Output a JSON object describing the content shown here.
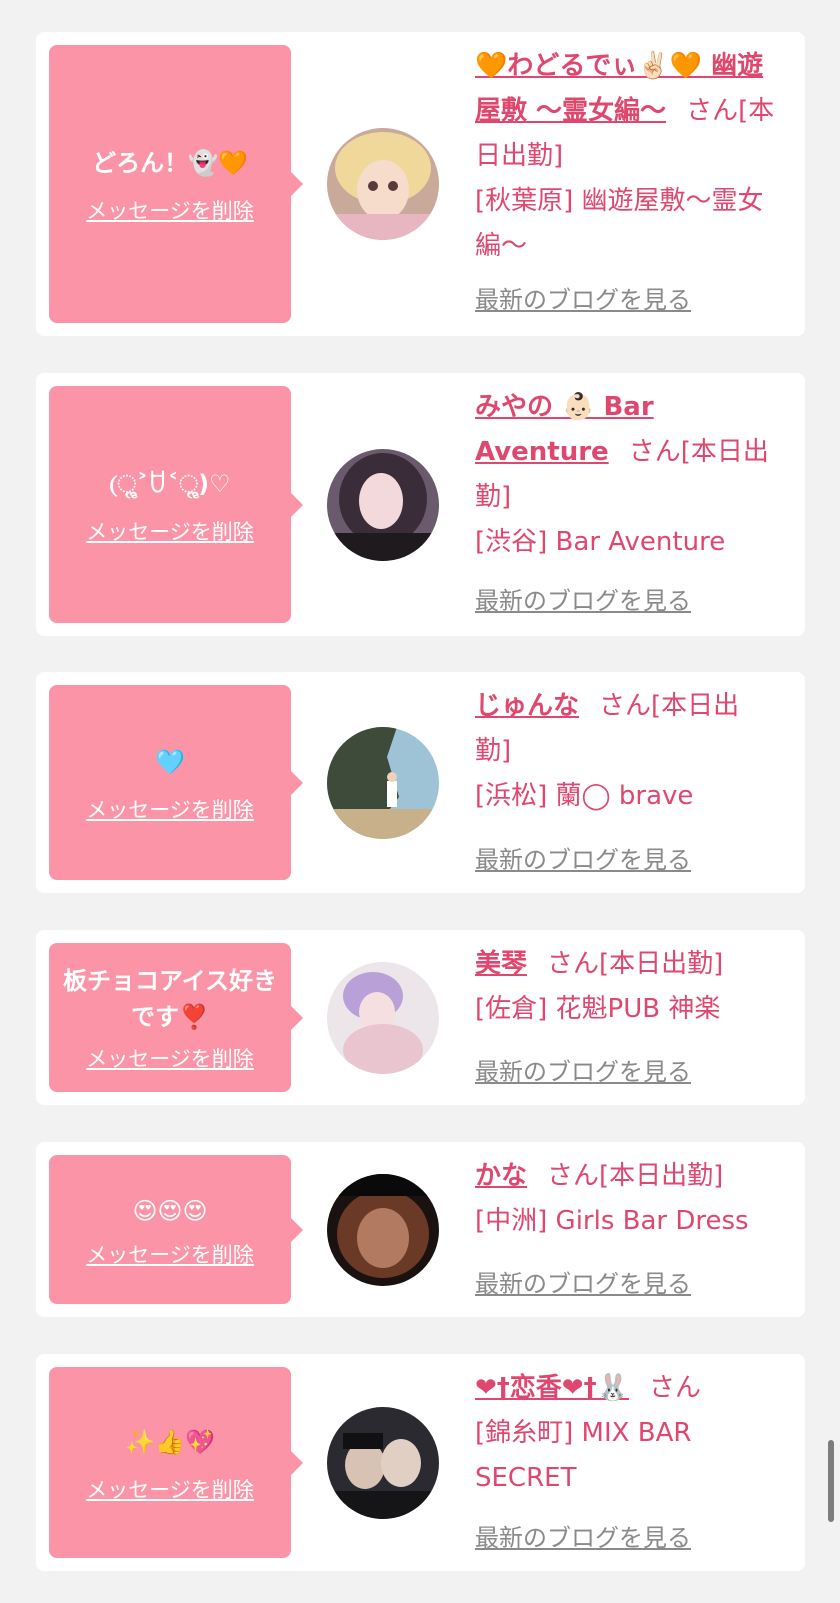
{
  "delete_label": "メッセージを削除",
  "blog_label": "最新のブログを見る",
  "colors": {
    "bubble": "#fa94a6",
    "name": "#e0476f",
    "link_gray": "#8a8a8a",
    "background": "#f2f2f2"
  },
  "cards": [
    {
      "message": "どろん！👻🧡",
      "name": "🧡わどるでぃ✌🏻🧡 幽遊屋敷 〜霊女編〜",
      "san": "さん[本日出勤]",
      "shop": "[秋葉原] 幽遊屋敷〜霊女編〜"
    },
    {
      "message": "(ૢ˃ꇴ˂ૢ)♡",
      "name": "みやの 👶🏻 Bar Aventure",
      "san": "さん[本日出勤]",
      "shop": "[渋谷] Bar Aventure"
    },
    {
      "message": "🩵",
      "name": "じゅんな",
      "san": "さん[本日出勤]",
      "shop": "[浜松] 蘭◯ brave"
    },
    {
      "message": "板チョコアイス好きです❣️",
      "name": "美琴",
      "san": "さん[本日出勤]",
      "shop": "[佐倉] 花魁PUB 神楽"
    },
    {
      "message": "😍😍😍",
      "name": "かな",
      "san": "さん[本日出勤]",
      "shop": "[中洲] Girls Bar Dress"
    },
    {
      "message": "✨👍💖",
      "name": "❤︎†恋香❤︎†🐰",
      "san": "さん",
      "shop": "[錦糸町] MIX BAR SECRET"
    }
  ]
}
